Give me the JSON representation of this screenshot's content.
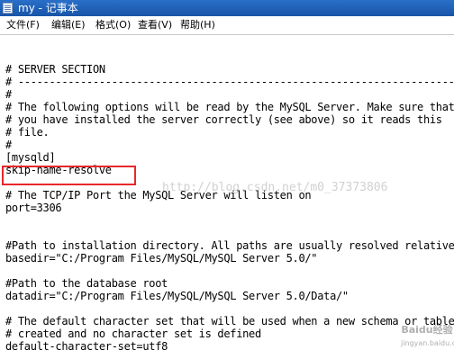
{
  "window": {
    "title": "my - 记事本"
  },
  "menu": {
    "file": "文件(F)",
    "edit": "编辑(E)",
    "format": "格式(O)",
    "view": "查看(V)",
    "help": "帮助(H)"
  },
  "editor": {
    "lines": [
      "# SERVER SECTION",
      "# ----------------------------------------------------------------------",
      "#",
      "# The following options will be read by the MySQL Server. Make sure that",
      "# you have installed the server correctly (see above) so it reads this",
      "# file.",
      "#",
      "[mysqld]",
      "skip-name-resolve",
      "",
      "# The TCP/IP Port the MySQL Server will listen on",
      "port=3306",
      "",
      "",
      "#Path to installation directory. All paths are usually resolved relative",
      "basedir=\"C:/Program Files/MySQL/MySQL Server 5.0/\"",
      "",
      "#Path to the database root",
      "datadir=\"C:/Program Files/MySQL/MySQL Server 5.0/Data/\"",
      "",
      "# The default character set that will be used when a new schema or table",
      "# created and no character set is defined",
      "default-character-set=utf8"
    ]
  },
  "watermark": "http://blog.csdn.net/m0_37373806",
  "badge": {
    "brand": "Baidu经验",
    "url": "jingyan.baidu.com"
  },
  "colors": {
    "titlebar": "#1855a8",
    "highlight": "#e8282a"
  }
}
